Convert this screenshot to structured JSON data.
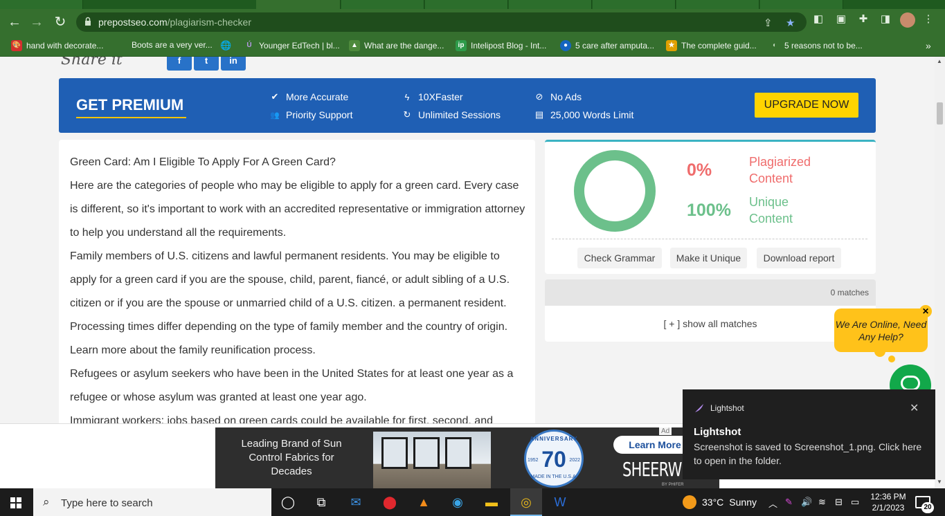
{
  "browser": {
    "url_domain": "prepostseo.com",
    "url_path": "/plagiarism-checker",
    "bookmarks": [
      {
        "label": "hand with decorate...",
        "color": "#d32f2f",
        "glyph": "🎨"
      },
      {
        "label": "Boots are a very ver...",
        "color": "#356f2e",
        "glyph": ""
      },
      {
        "label": "",
        "color": "#356f2e",
        "glyph": "🌐"
      },
      {
        "label": "Younger EdTech | bl...",
        "color": "#7a5cc0",
        "glyph": "Ú"
      },
      {
        "label": "What are the dange...",
        "color": "#4e8a3c",
        "glyph": "▲"
      },
      {
        "label": "Intelipost Blog - Int...",
        "color": "#2e9b4a",
        "glyph": "ip"
      },
      {
        "label": "5 care after amputa...",
        "color": "#1565c0",
        "glyph": "●"
      },
      {
        "label": "The complete guid...",
        "color": "#e0a000",
        "glyph": "★"
      },
      {
        "label": "5 reasons not to be...",
        "color": "#356f2e",
        "glyph": "◐"
      }
    ],
    "bookmarks_more": "»"
  },
  "page": {
    "share_text": "Share it",
    "social": [
      {
        "name": "facebook",
        "glyph": "f"
      },
      {
        "name": "twitter",
        "glyph": "t"
      },
      {
        "name": "linkedin",
        "glyph": "in"
      }
    ],
    "premium": {
      "title": "GET PREMIUM",
      "features": [
        {
          "icon": "check-icon",
          "glyph": "✔",
          "label": "More Accurate"
        },
        {
          "icon": "users-icon",
          "glyph": "👥",
          "label": "Priority Support"
        },
        {
          "icon": "bolt-icon",
          "glyph": "ϟ",
          "label": "10XFaster"
        },
        {
          "icon": "refresh-icon",
          "glyph": "↻",
          "label": "Unlimited Sessions"
        },
        {
          "icon": "no-ads-icon",
          "glyph": "⊘",
          "label": "No Ads"
        },
        {
          "icon": "document-icon",
          "glyph": "▤",
          "label": "25,000 Words Limit"
        }
      ],
      "upgrade_label": "UPGRADE NOW"
    },
    "text_paragraphs": [
      "Green Card: Am I Eligible To Apply For A Green Card?",
      "Here are the categories of people who may be eligible to apply for a green card. Every case is different, so it's important to work with an accredited representative or immigration attorney to help you understand all the requirements.",
      "Family members of U.S.  citizens and lawful permanent residents. You may be eligible to apply for a green card if you are the spouse, child, parent, fiancé, or adult sibling of a U.S. citizen or if you are the spouse or unmarried child of a U.S. citizen. a permanent resident. Processing times differ depending on the type of family member and the country of origin. Learn more about the family reunification process.",
      "Refugees or asylum seekers who have been in the United States for at least one year as a refugee or whose asylum was granted at least one year ago.",
      "Immigrant workers: jobs based on green cards could be available for first, second, and"
    ],
    "result": {
      "plagiarized_pct": "0%",
      "plagiarized_label": "Plagiarized Content",
      "unique_pct": "100%",
      "unique_label": "Unique Content",
      "plagiarized_color": "#ef6c6c",
      "unique_color": "#6cc08b",
      "actions": [
        "Check Grammar",
        "Make it Unique",
        "Download report"
      ]
    },
    "matches_count": "0 matches",
    "show_all_matches": "[ + ] show all matches",
    "chat": {
      "bubble_text": "We Are Online, Need Any Help?",
      "close_glyph": "✕"
    },
    "ad": {
      "tagline": "Leading Brand of Sun Control Fabrics for Decades",
      "anniversary_number": "70",
      "anniversary_ring": "ANNIVERSARY",
      "year_start": "1952",
      "year_end": "2022",
      "made_in": "MADE IN THE U.S.A.",
      "learn_more": "Learn More",
      "brand": "SHEERWEAVE",
      "by": "BY PHIFER",
      "ad_label": "Ad"
    }
  },
  "toast": {
    "app_name": "Lightshot",
    "title": "Lightshot",
    "body": "Screenshot is saved to Screenshot_1.png. Click here to open in the folder.",
    "close_glyph": "✕"
  },
  "taskbar": {
    "search_placeholder": "Type here to search",
    "weather_temp": "33°C",
    "weather_text": "Sunny",
    "time": "12:36 PM",
    "date": "2/1/2023",
    "notification_count": "20"
  }
}
